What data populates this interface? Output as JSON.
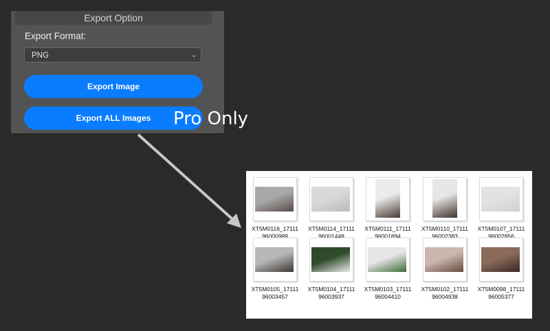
{
  "panel": {
    "title": "Export Option",
    "format_label": "Export Format:",
    "format_value": "PNG",
    "export_image_label": "Export Image",
    "export_all_label": "Export ALL Images"
  },
  "overlay": {
    "pro_only": "Pro Only"
  },
  "files": [
    {
      "line1": "XT5M0116_17111",
      "line2": "96000989",
      "colors": [
        "#a8a8a8",
        "#5a4a48"
      ],
      "shape": "wide"
    },
    {
      "line1": "XT5M0114_17111",
      "line2": "96001448",
      "colors": [
        "#d8d8d8",
        "#bcbcbc"
      ],
      "shape": "wide"
    },
    {
      "line1": "XT5M0111_17111",
      "line2": "96001894",
      "colors": [
        "#ebebeb",
        "#4a3a34"
      ],
      "shape": "tall"
    },
    {
      "line1": "XT5M0110_17111",
      "line2": "96002383",
      "colors": [
        "#e6e6e6",
        "#3f302a"
      ],
      "shape": "tall"
    },
    {
      "line1": "XT5M0107_17111",
      "line2": "96002856",
      "colors": [
        "#e2e2e2",
        "#cfcfcf"
      ],
      "shape": "wide"
    },
    {
      "line1": "XT5M0105_17111",
      "line2": "96003457",
      "colors": [
        "#b7b7b7",
        "#3b352f"
      ],
      "shape": "wide"
    },
    {
      "line1": "XT5M0104_17111",
      "line2": "96003937",
      "colors": [
        "#2e4a2a",
        "#e8e8e8"
      ],
      "shape": "wide"
    },
    {
      "line1": "XT5M0103_17111",
      "line2": "96004410",
      "colors": [
        "#e6e6e6",
        "#3a6a34"
      ],
      "shape": "wide"
    },
    {
      "line1": "XT5M0102_17111",
      "line2": "96004938",
      "colors": [
        "#c9b7b0",
        "#6a4a3e"
      ],
      "shape": "wide"
    },
    {
      "line1": "XT5M0098_17111",
      "line2": "96005377",
      "colors": [
        "#8a6a5a",
        "#3a2a24"
      ],
      "shape": "wide"
    }
  ]
}
